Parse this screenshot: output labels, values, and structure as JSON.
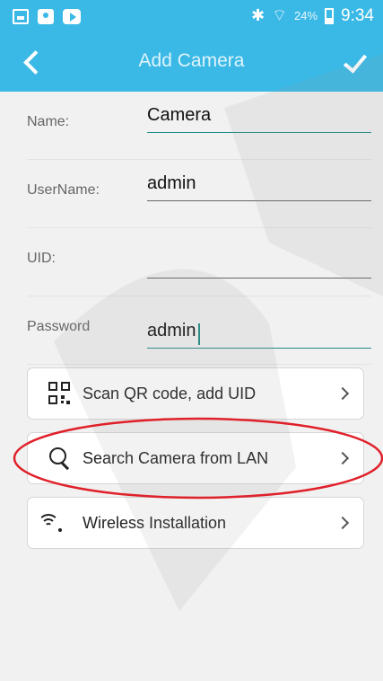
{
  "status_bar": {
    "battery_percent": "24%",
    "time": "9:34",
    "bluetooth_glyph": "✱",
    "wifi_glyph": "⌔"
  },
  "header": {
    "title": "Add Camera"
  },
  "form": {
    "name_label": "Name:",
    "name_value": "Camera",
    "username_label": "UserName:",
    "username_value": "admin",
    "uid_label": "UID:",
    "uid_value": "",
    "password_label": "Password",
    "password_value": "admin"
  },
  "actions": {
    "scan_qr_label": "Scan QR code, add UID",
    "search_lan_label": "Search Camera from LAN",
    "wireless_label": "Wireless Installation"
  },
  "colors": {
    "accent": "#3ab9e6",
    "focus_underline": "#1f8c86",
    "highlight_ellipse": "#e0202a"
  },
  "icons": [
    "back-arrow-icon",
    "checkmark-icon",
    "qr-code-icon",
    "search-icon",
    "wifi-icon",
    "chevron-right-icon"
  ]
}
